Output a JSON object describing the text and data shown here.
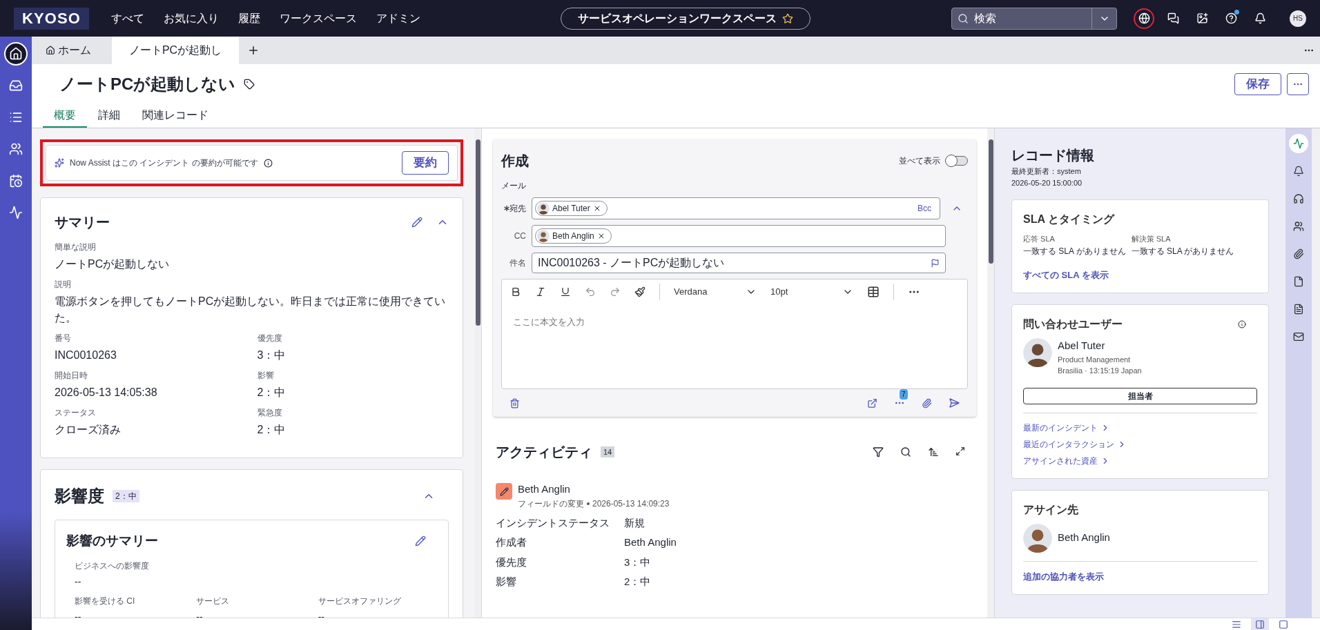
{
  "top_nav": {
    "logo": "KYOSO",
    "menu": [
      "すべて",
      "お気に入り",
      "履歴",
      "ワークスペース",
      "アドミン"
    ],
    "workspace": "サービスオペレーションワークスペース",
    "search": {
      "placeholder": "検索"
    },
    "icons": [
      {
        "kind": "globe",
        "highlighted": true,
        "notification": false
      },
      {
        "kind": "chat",
        "highlighted": false,
        "notification": false
      },
      {
        "kind": "image",
        "highlighted": false,
        "notification": false
      },
      {
        "kind": "help",
        "highlighted": false,
        "notification": true
      },
      {
        "kind": "bell",
        "highlighted": false,
        "notification": false
      }
    ],
    "avatar_initials": "HS"
  },
  "sidebar": [
    {
      "kind": "home",
      "selected": true
    },
    {
      "kind": "inbox",
      "selected": false
    },
    {
      "kind": "list",
      "selected": false
    },
    {
      "kind": "groups",
      "selected": false
    },
    {
      "kind": "calendar",
      "selected": false
    },
    {
      "kind": "pulse",
      "selected": false
    }
  ],
  "tab_strip": [
    {
      "kind": "home",
      "label": "ホーム",
      "selected": false
    },
    {
      "kind": "record",
      "label": "ノートPCが起動し",
      "selected": true
    }
  ],
  "record": {
    "title": "ノートPCが起動しない",
    "save": "保存",
    "tabs": [
      {
        "label": "概要",
        "selected": true
      },
      {
        "label": "詳細",
        "selected": false
      },
      {
        "label": "関連レコード",
        "selected": false
      }
    ]
  },
  "assist_banner": {
    "text": "Now Assist はこの インシデント の要約が可能です",
    "button": "要約",
    "highlighted": true
  },
  "summary": {
    "title": "サマリー",
    "expanded": true,
    "fields": [
      {
        "label": "簡単な説明",
        "value": "ノートPCが起動しない",
        "kind": "full"
      },
      {
        "label": "説明",
        "value": "電源ボタンを押してもノートPCが起動しない。昨日までは正常に使用できていた。",
        "kind": "full"
      },
      {
        "label": "番号",
        "value": "INC0010263",
        "kind": "half"
      },
      {
        "label": "優先度",
        "value": "3：中",
        "kind": "half"
      },
      {
        "label": "開始日時",
        "value": "2026-05-13 14:05:38",
        "kind": "half"
      },
      {
        "label": "影響",
        "value": "2：中",
        "kind": "half"
      },
      {
        "label": "ステータス",
        "value": "クローズ済み",
        "kind": "half"
      },
      {
        "label": "緊急度",
        "value": "2：中",
        "kind": "half"
      }
    ]
  },
  "impact": {
    "title": "影響度",
    "badge": "2：中",
    "expanded": true,
    "card": {
      "title": "影響のサマリー",
      "fields": [
        {
          "label": "ビジネスへの影響度",
          "value": "--",
          "kind": "full"
        },
        {
          "label": "影響を受ける CI",
          "value": "--",
          "kind": "third"
        },
        {
          "label": "サービス",
          "value": "--",
          "kind": "third"
        },
        {
          "label": "サービスオファリング",
          "value": "--",
          "kind": "third"
        }
      ]
    }
  },
  "compose": {
    "title": "作成",
    "side_by_side": {
      "label": "並べて表示",
      "on": false
    },
    "channel": "メール",
    "to": {
      "label": "宛先",
      "required": true,
      "recipients": [
        "Abel Tuter"
      ],
      "bcc": "Bcc"
    },
    "cc": {
      "label": "CC",
      "recipients": [
        "Beth Anglin"
      ]
    },
    "subject": {
      "label": "件名",
      "value": "INC0010263 - ノートPCが起動しない"
    },
    "font": "Verdana",
    "size": "10pt",
    "body_placeholder": "ここに本文を入力",
    "more_badge": "7"
  },
  "activity": {
    "title": "アクティビティ",
    "count": "14",
    "entries": [
      {
        "author": "Beth Anglin",
        "type": "フィールドの変更",
        "time": "2026-05-13 14:09:23",
        "changes": [
          {
            "field": "インシデントステータス",
            "value": "新規"
          },
          {
            "field": "作成者",
            "value": "Beth Anglin"
          },
          {
            "field": "優先度",
            "value": "3：中"
          },
          {
            "field": "影響",
            "value": "2：中"
          }
        ]
      }
    ]
  },
  "record_info": {
    "title": "レコード情報",
    "updated_by": "最終更新者：system",
    "updated_at": "2026-05-20 15:00:00"
  },
  "sla": {
    "title": "SLA とタイミング",
    "columns": [
      {
        "label": "応答 SLA",
        "value": "一致する SLA がありません"
      },
      {
        "label": "解決策 SLA",
        "value": "一致する SLA がありません"
      }
    ],
    "link": "すべての SLA を表示"
  },
  "caller": {
    "title": "問い合わせユーザー",
    "name": "Abel Tuter",
    "department": "Product Management",
    "location": "Brasilia · 13:15:19 Japan",
    "button": "担当者",
    "links": [
      "最新のインシデント",
      "最近のインタラクション",
      "アサインされた資産"
    ]
  },
  "assignee": {
    "title": "アサイン先",
    "name": "Beth Anglin",
    "link": "追加の協力者を表示"
  },
  "right_rail": [
    {
      "kind": "pulse",
      "selected": true
    },
    {
      "kind": "bell",
      "selected": false
    },
    {
      "kind": "headset",
      "selected": false
    },
    {
      "kind": "groups",
      "selected": false
    },
    {
      "kind": "attachment",
      "selected": false
    },
    {
      "kind": "document",
      "selected": false
    },
    {
      "kind": "document_lines",
      "selected": false
    },
    {
      "kind": "mail",
      "selected": false
    }
  ],
  "view_modes": [
    {
      "kind": "list",
      "selected": false
    },
    {
      "kind": "split",
      "selected": true
    },
    {
      "kind": "single",
      "selected": false
    }
  ]
}
